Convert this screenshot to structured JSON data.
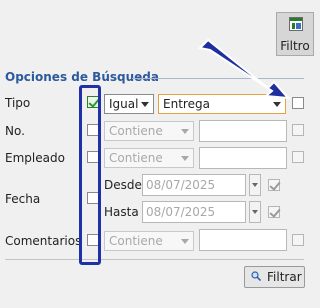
{
  "toolbar": {
    "filter_label": "Filtro",
    "icon": "filter-panel-icon"
  },
  "group": {
    "legend": "Opciones de Búsqueda"
  },
  "rows": {
    "tipo": {
      "label": "Tipo",
      "operator": "Igual",
      "value": "Entrega"
    },
    "no": {
      "label": "No.",
      "operator": "Contiene"
    },
    "empleado": {
      "label": "Empleado",
      "operator": "Contiene"
    },
    "fecha": {
      "label": "Fecha",
      "desde_label": "Desde",
      "desde_value": "08/07/2025",
      "hasta_label": "Hasta",
      "hasta_value": "08/07/2025"
    },
    "comentarios": {
      "label": "Comentarios",
      "operator": "Contiene"
    }
  },
  "actions": {
    "filter_button": "Filtrar",
    "filter_button_icon": "magnifier-icon"
  },
  "annotation": {
    "rect_color": "#2030a8",
    "arrow_color": "#1f2fa0"
  }
}
